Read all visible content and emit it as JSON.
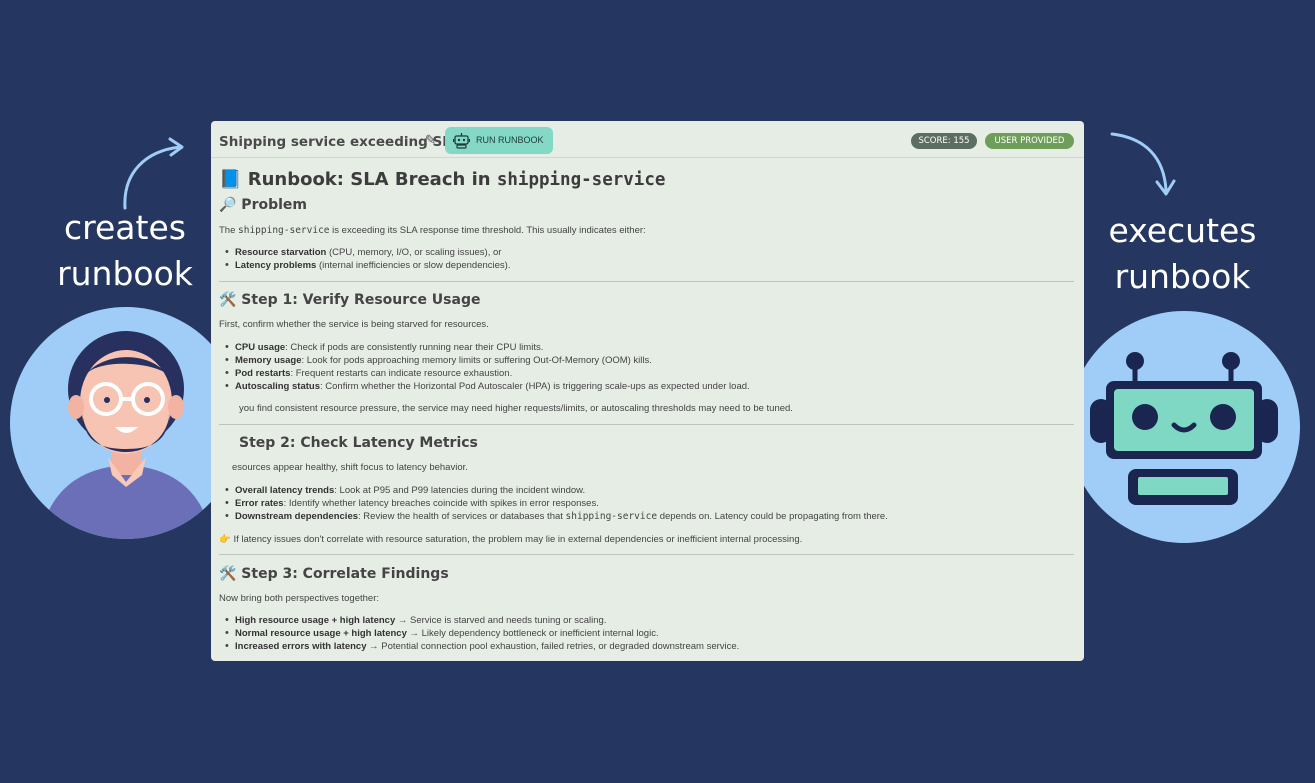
{
  "left": {
    "label_line1": "creates",
    "label_line2": "runbook"
  },
  "right": {
    "label_line1": "executes",
    "label_line2": "runbook"
  },
  "panel": {
    "title": "Shipping service exceeding SLA",
    "run_button": "RUN RUNBOOK",
    "score_badge": "SCORE: 155",
    "source_badge": "USER PROVIDED"
  },
  "doc": {
    "title_icon": "📘",
    "title_prefix": "Runbook: SLA Breach in ",
    "title_code": "shipping-service",
    "problem_heading": "🔎 Problem",
    "problem_pre": "The ",
    "problem_code": "shipping-service",
    "problem_post": " is exceeding its SLA response time threshold. This usually indicates either:",
    "problem_items": [
      {
        "bold": "Resource starvation",
        "text": " (CPU, memory, I/O, or scaling issues), or"
      },
      {
        "bold": "Latency problems",
        "text": " (internal inefficiencies or slow dependencies)."
      }
    ],
    "step1_heading": "🛠️ Step 1: Verify Resource Usage",
    "step1_intro": "First, confirm whether the service is being starved for resources.",
    "step1_items": [
      {
        "bold": "CPU usage",
        "text": ": Check if pods are consistently running near their CPU limits."
      },
      {
        "bold": "Memory usage",
        "text": ": Look for pods approaching memory limits or suffering Out-Of-Memory (OOM) kills."
      },
      {
        "bold": "Pod restarts",
        "text": ": Frequent restarts can indicate resource exhaustion."
      },
      {
        "bold": "Autoscaling status",
        "text": ": Confirm whether the Horizontal Pod Autoscaler (HPA) is triggering scale-ups as expected under load."
      }
    ],
    "step1_note": "you find consistent resource pressure, the service may need higher requests/limits, or autoscaling thresholds may need to be tuned.",
    "step2_heading": "Step 2: Check Latency Metrics",
    "step2_intro": "esources appear healthy, shift focus to latency behavior.",
    "step2_items": [
      {
        "bold": "Overall latency trends",
        "text": ": Look at P95 and P99 latencies during the incident window."
      },
      {
        "bold": "Error rates",
        "text": ": Identify whether latency breaches coincide with spikes in error responses."
      }
    ],
    "step2_item3_bold": "Downstream dependencies",
    "step2_item3_pre": ": Review the health of services or databases that ",
    "step2_item3_code": "shipping-service",
    "step2_item3_post": " depends on. Latency could be propagating from there.",
    "step2_note": "👉 If latency issues don't correlate with resource saturation, the problem may lie in external dependencies or inefficient internal processing.",
    "step3_heading": "🛠️ Step 3: Correlate Findings",
    "step3_intro": "Now bring both perspectives together:",
    "step3_items": [
      {
        "bold": "High resource usage + high latency",
        "text": " → Service is starved and needs tuning or scaling."
      },
      {
        "bold": "Normal resource usage + high latency",
        "text": " → Likely dependency bottleneck or inefficient internal logic."
      },
      {
        "bold": "Increased errors with latency",
        "text": " → Potential connection pool exhaustion, failed retries, or degraded downstream service."
      }
    ]
  },
  "colors": {
    "background": "#253660",
    "panel": "#e6ede5",
    "run_button": "#84d9c6",
    "score_badge": "#5c6d62",
    "source_badge": "#6f9d5a",
    "avatar_bg": "#9fcdf7"
  },
  "icons": [
    "pencil-icon",
    "robot-icon",
    "book-icon",
    "magnifier-icon",
    "tools-icon",
    "pointing-hand-icon"
  ]
}
